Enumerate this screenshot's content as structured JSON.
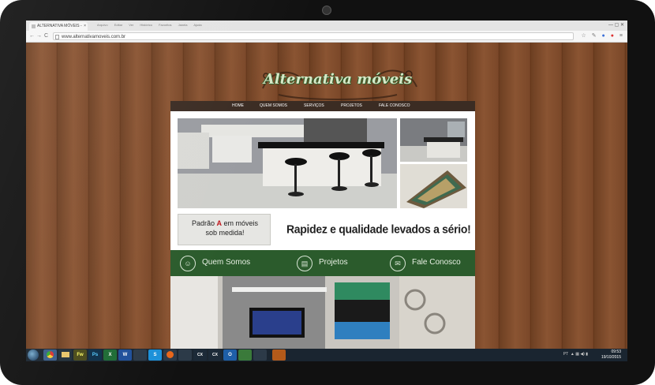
{
  "browser": {
    "tab_title": "ALTERNATIVA MÓVEIS - ",
    "tab_close": "×",
    "menu": [
      "Arquivo",
      "Editar",
      "Ver",
      "Histórico",
      "Favoritos",
      "Janela",
      "Ajuda"
    ],
    "url": "www.alternativamoveis.com.br",
    "back": "←",
    "forward": "→",
    "reload": "C",
    "star": "☆",
    "menu_icon": "≡"
  },
  "site": {
    "logo": "Alternativa móveis",
    "nav": [
      "HOME",
      "QUEM SOMOS",
      "SERVIÇOS",
      "PROJETOS",
      "FALE CONOSCO"
    ],
    "padrao_pre": "Padrão ",
    "padrao_a": "A",
    "padrao_post": " em móveis sob medida!",
    "slogan": "Rapidez e qualidade levados a sério!",
    "sections": [
      {
        "label": "Quem Somos",
        "icon": "people-icon",
        "glyph": "☺"
      },
      {
        "label": "Projetos",
        "icon": "document-icon",
        "glyph": "▤"
      },
      {
        "label": "Fale Conosco",
        "icon": "envelope-icon",
        "glyph": "✉"
      }
    ]
  },
  "taskbar": {
    "apps": [
      "",
      "",
      "Fw",
      "Ps",
      "X",
      "W",
      "",
      "S",
      "",
      "",
      "CX",
      "CX",
      "O",
      "",
      "",
      ""
    ],
    "lang": "PT",
    "time": "09:53",
    "date": "19/10/2015"
  },
  "colors": {
    "green": "#2b5b2c",
    "nav_bg": "#3b2c23",
    "wood": "#7b4829",
    "accent_red": "#c0141a"
  }
}
